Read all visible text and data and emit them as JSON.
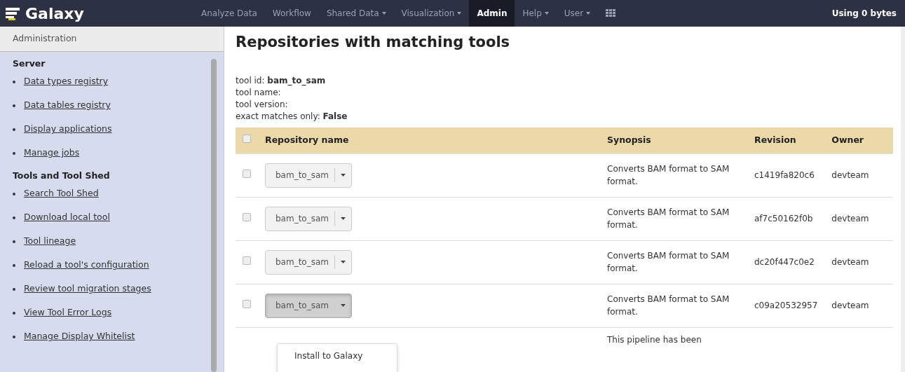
{
  "brand": "Galaxy",
  "nav": [
    {
      "label": "Analyze Data",
      "dropdown": false,
      "selected": false
    },
    {
      "label": "Workflow",
      "dropdown": false,
      "selected": false
    },
    {
      "label": "Shared Data",
      "dropdown": true,
      "selected": false
    },
    {
      "label": "Visualization",
      "dropdown": true,
      "selected": false
    },
    {
      "label": "Admin",
      "dropdown": false,
      "selected": true
    },
    {
      "label": "Help",
      "dropdown": true,
      "selected": false
    },
    {
      "label": "User",
      "dropdown": true,
      "selected": false
    }
  ],
  "usage": "Using 0 bytes",
  "sidebar": {
    "title": "Administration",
    "sections": [
      {
        "heading": "Server",
        "items": [
          "Data types registry",
          "Data tables registry",
          "Display applications",
          "Manage jobs"
        ]
      },
      {
        "heading": "Tools and Tool Shed",
        "items": [
          "Search Tool Shed",
          "Download local tool",
          "Tool lineage",
          "Reload a tool's configuration",
          "Review tool migration stages",
          "View Tool Error Logs",
          "Manage Display Whitelist"
        ]
      }
    ]
  },
  "page_title": "Repositories with matching tools",
  "info": [
    "tool id: **bam_to_sam**",
    "tool name:",
    "tool version:",
    "exact matches only: **False**"
  ],
  "table": {
    "columns": [
      "Repository name",
      "Synopsis",
      "Revision",
      "Owner"
    ],
    "header_checked": false,
    "rows": [
      {
        "checked": false,
        "name": "bam_to_sam",
        "open": false,
        "synopsis": "Converts BAM format to SAM format.",
        "revision": "c1419fa820c6",
        "owner": "devteam"
      },
      {
        "checked": false,
        "name": "bam_to_sam",
        "open": false,
        "synopsis": "Converts BAM format to SAM format.",
        "revision": "af7c50162f0b",
        "owner": "devteam"
      },
      {
        "checked": false,
        "name": "bam_to_sam",
        "open": false,
        "synopsis": "Converts BAM format to SAM format.",
        "revision": "dc20f447c0e2",
        "owner": "devteam"
      },
      {
        "checked": false,
        "name": "bam_to_sam",
        "open": true,
        "synopsis": "Converts BAM format to SAM format.",
        "revision": "c09a20532957",
        "owner": "devteam"
      },
      {
        "synopsis": "This pipeline has been"
      }
    ]
  },
  "menu": [
    "Install to Galaxy"
  ]
}
